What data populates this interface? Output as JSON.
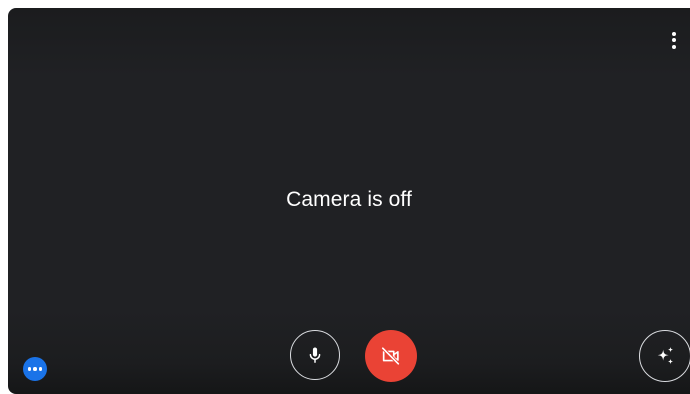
{
  "preview": {
    "status_text": "Camera is off"
  },
  "controls": {
    "options_icon": "more-vert-icon",
    "microphone_icon": "microphone-icon",
    "camera_icon": "camera-off-icon",
    "effects_icon": "sparkle-icon",
    "more_icon": "more-horiz-icon"
  },
  "colors": {
    "background": "#202124",
    "camera_off_button": "#ea4335",
    "more_button": "#1a73e8",
    "text": "#ffffff"
  }
}
